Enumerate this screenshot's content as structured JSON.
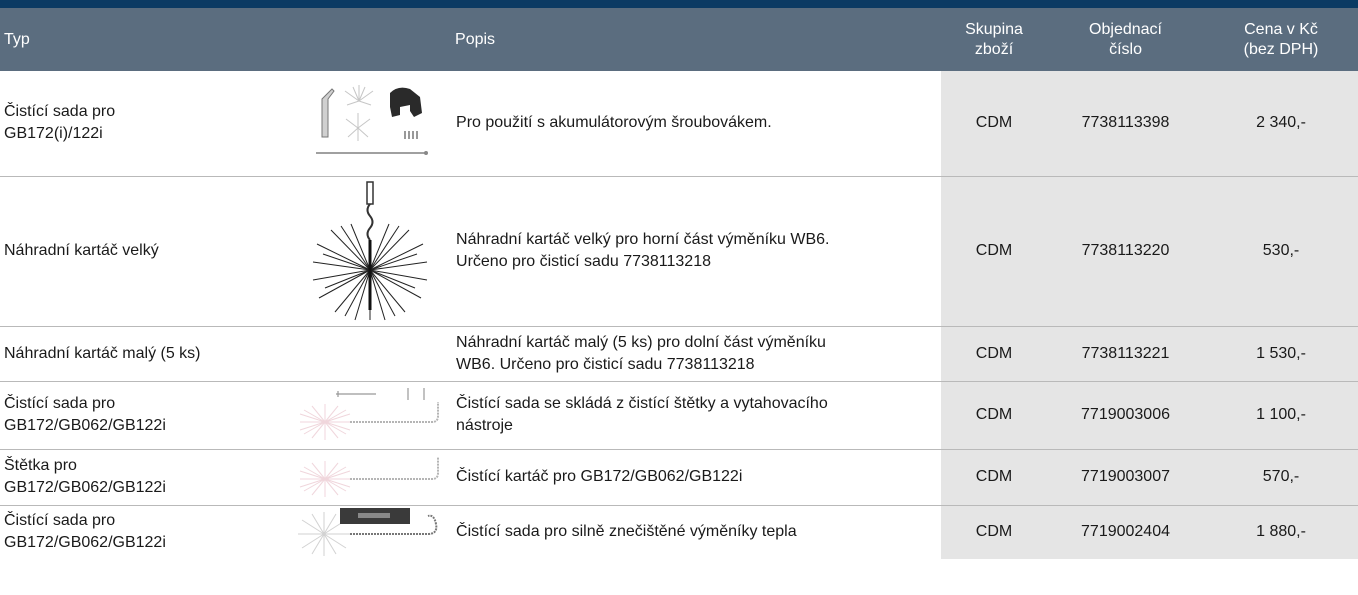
{
  "header": {
    "typ": "Typ",
    "popis": "Popis",
    "skupina": [
      "Skupina",
      "zboží"
    ],
    "objednaci": [
      "Objednací",
      "číslo"
    ],
    "cena": [
      "Cena v Kč",
      "(bez DPH)"
    ]
  },
  "rows": [
    {
      "typ": [
        "Čistící sada pro",
        "GB172(i)/122i"
      ],
      "image": "cleaning-kit-cordless-image",
      "popis": [
        "Pro použití s akumulátorovým šroubovákem."
      ],
      "skupina": "CDM",
      "cislo": "7738113398",
      "cena": "2 340,-"
    },
    {
      "typ": [
        "Náhradní kartáč velký"
      ],
      "image": "large-brush-image",
      "popis": [
        "Náhradní kartáč velký pro horní část výměníku WB6.",
        "Určeno pro čisticí sadu 7738113218"
      ],
      "skupina": "CDM",
      "cislo": "7738113220",
      "cena": "530,-"
    },
    {
      "typ": [
        "Náhradní kartáč malý (5 ks)"
      ],
      "image": "",
      "popis": [
        "Náhradní kartáč malý (5 ks) pro dolní část výměníku",
        "WB6. Určeno pro čisticí sadu 7738113218"
      ],
      "skupina": "CDM",
      "cislo": "7738113221",
      "cena": "1 530,-"
    },
    {
      "typ": [
        "Čistící sada pro",
        "GB172/GB062/GB122i"
      ],
      "image": "brush-with-tool-image",
      "popis": [
        "Čistící sada se skládá z čistící štětky a vytahovacího",
        "nástroje"
      ],
      "skupina": "CDM",
      "cislo": "7719003006",
      "cena": "1 100,-"
    },
    {
      "typ": [
        "Štětka pro",
        "GB172/GB062/GB122i"
      ],
      "image": "brush-image",
      "popis": [
        "Čistící kartáč pro GB172/GB062/GB122i"
      ],
      "skupina": "CDM",
      "cislo": "7719003007",
      "cena": "570,-"
    },
    {
      "typ": [
        "Čistící sada pro",
        "GB172/GB062/GB122i"
      ],
      "image": "heavy-duty-kit-image",
      "popis": [
        "Čistící sada pro silně znečištěné výměníky tepla"
      ],
      "skupina": "CDM",
      "cislo": "7719002404",
      "cena": "1 880,-"
    }
  ]
}
